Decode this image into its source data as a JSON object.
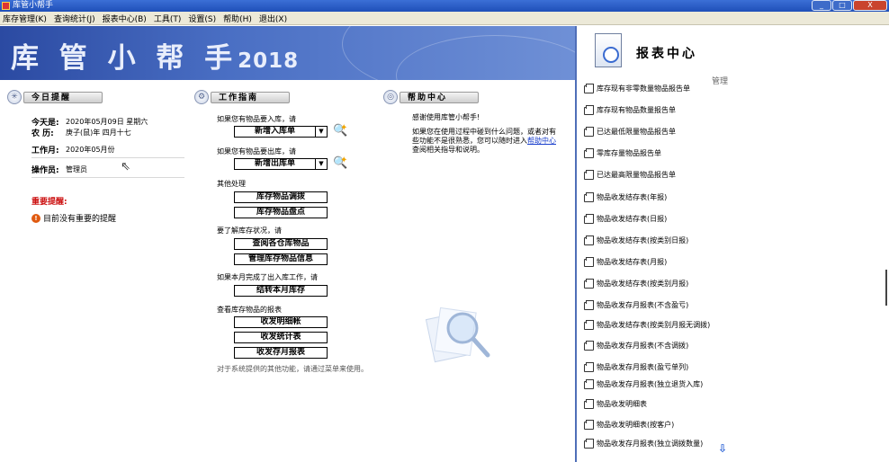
{
  "window": {
    "title": "库管小帮手",
    "controls": [
      "_",
      "□",
      "X"
    ]
  },
  "menu": [
    "库存管理(K)",
    "查询统计(J)",
    "报表中心(B)",
    "工具(T)",
    "设置(S)",
    "帮助(H)",
    "退出(X)"
  ],
  "banner": {
    "title": "库 管 小 帮 手",
    "year": "2018"
  },
  "today": {
    "header": "今日提醒",
    "today_label": "今天是:",
    "today_value": "2020年05月09日  星期六",
    "lunar_label": "农   历:",
    "lunar_value": "庚子(鼠)年 四月十七",
    "workmonth_label": "工作月:",
    "workmonth_value": "2020年05月份",
    "operator_label": "操作员:",
    "operator_value": "管理员",
    "reminder_title": "重要提醒:",
    "reminder_item": "目前没有重要的提醒"
  },
  "guide": {
    "header": "工作指南",
    "line_in": "如果您有物品要入库，请",
    "btn_in": "新增入库单",
    "line_out": "如果您有物品要出库，请",
    "btn_out": "新增出库单",
    "line_other": "其他处理",
    "btn_transfer": "库存物品调拨",
    "btn_count": "库存物品盘点",
    "line_status": "要了解库存状况，请",
    "btn_query": "查阅各仓库物品",
    "btn_manage": "管理库存物品信息",
    "line_month": "如果本月完成了出入库工作，请",
    "btn_close": "结转本月库存",
    "line_report": "查看库存物品的报表",
    "btn_detail": "收发明细帐",
    "btn_stat": "收发统计表",
    "btn_monthly": "收发存月报表",
    "footer": "对于系统提供的其他功能，请通过菜单来使用。"
  },
  "help": {
    "header": "帮助中心",
    "welcome": "感谢使用库管小帮手!",
    "body_1": "如果您在使用过程中碰到什么问题，或者对有些功能不是很熟悉，您可以随时进入",
    "link": "帮助中心",
    "body_2": "查阅相关指导和说明。"
  },
  "reports": {
    "title": "报表中心",
    "manage": "管理",
    "items": [
      "库存现有非零数量物品报告单",
      "库存现有物品数量报告单",
      "已达最低限量物品报告单",
      "零库存量物品报告单",
      "已达最高限量物品报告单",
      "物品收发结存表(年报)",
      "物品收发结存表(日报)",
      "物品收发结存表(按类别日报)",
      "物品收发结存表(月报)",
      "物品收发结存表(按类别月报)",
      "物品收发存月报表(不含盈亏)",
      "物品收发结存表(按类别月报无调拨)",
      "物品收发存月报表(不含调拨)",
      "物品收发存月报表(盈亏单列)",
      "物品收发存月报表(独立退货入库)",
      "物品收发明细表",
      "物品收发明细表(按客户)",
      "物品收发存月报表(独立调拨数量)"
    ]
  }
}
